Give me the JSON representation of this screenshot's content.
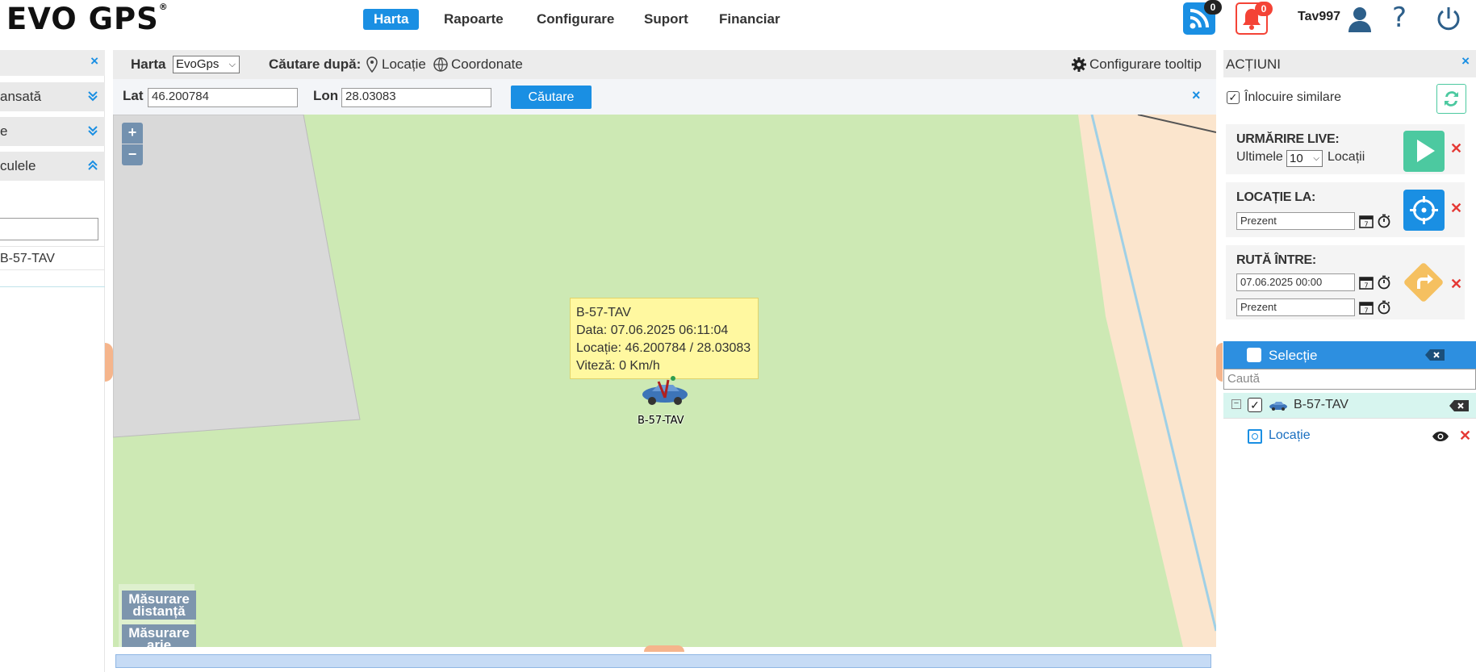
{
  "app": {
    "logo": "EVO GPS",
    "logo_mark": "®"
  },
  "nav": [
    {
      "label": "Harta",
      "active": true
    },
    {
      "label": "Rapoarte"
    },
    {
      "label": "Configurare"
    },
    {
      "label": "Suport"
    },
    {
      "label": "Financiar"
    }
  ],
  "header": {
    "rss_count": "0",
    "alerts_count": "0",
    "username": "Tav997"
  },
  "left_panel": {
    "section1": "ansată",
    "section2": "e",
    "section3": "culele",
    "vehicle": "B-57-TAV"
  },
  "map_toolbar": {
    "map_label": "Harta",
    "map_select": "EvoGps",
    "search_by_label": "Căutare după:",
    "location_option": "Locație",
    "coords_option": "Coordonate",
    "tooltip_config": "Configurare tooltip",
    "lat_label": "Lat",
    "lat_value": "46.200784",
    "lon_label": "Lon",
    "lon_value": "28.03083",
    "search_button": "Căutare"
  },
  "map": {
    "zoom_in": "+",
    "zoom_out": "−",
    "measure_distance": "Măsurare distanță",
    "measure_area": "Măsurare arie",
    "marker_label": "B-57-TAV",
    "tooltip": {
      "line1": "B-57-TAV",
      "line2": "Data: 07.06.2025 06:11:04",
      "line3": "Locație: 46.200784 / 28.03083",
      "line4": "Viteză: 0 Km/h"
    }
  },
  "actions": {
    "title": "ACȚIUNI",
    "replace_similar": "Înlocuire similare",
    "live_title": "URMĂRIRE LIVE:",
    "live_last": "Ultimele",
    "live_count": "10",
    "live_locations": "Locații",
    "location_at_title": "LOCAȚIE LA:",
    "location_at_value": "Prezent",
    "route_title": "RUTĂ ÎNTRE:",
    "route_from": "07.06.2025 00:00",
    "route_to": "Prezent"
  },
  "selection": {
    "title": "Selecție",
    "search_placeholder": "Caută",
    "vehicle": "B-57-TAV",
    "layer": "Locație"
  },
  "colors": {
    "accent": "#1a8fe3",
    "live_green": "#4cc9a0",
    "route_orange": "#f5c060",
    "alert_red": "#f44336",
    "map_green": "#cde9b4"
  }
}
